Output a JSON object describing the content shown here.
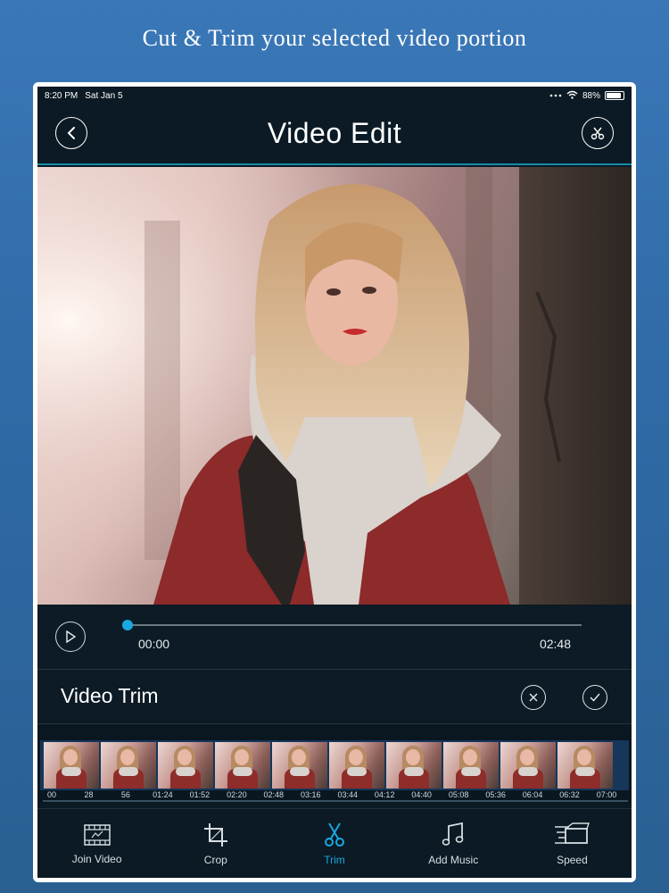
{
  "headline": "Cut & Trim your selected video portion",
  "status": {
    "time": "8:20 PM",
    "date": "Sat Jan 5",
    "battery": "88%",
    "battery_level": 0.88
  },
  "nav": {
    "title": "Video Edit",
    "back_icon": "chevron-left-icon",
    "share_icon": "scissors-icon"
  },
  "player": {
    "current_time": "00:00",
    "duration": "02:48",
    "progress": 0.0
  },
  "trim": {
    "title": "Video Trim"
  },
  "timeline": {
    "ticks": [
      "00",
      "28",
      "56",
      "01:24",
      "01:52",
      "02:20",
      "02:48",
      "03:16",
      "03:44",
      "04:12",
      "04:40",
      "05:08",
      "05:36",
      "06:04",
      "06:32",
      "07:00"
    ]
  },
  "toolbar": {
    "items": [
      {
        "label": "Join Video",
        "icon": "film-icon"
      },
      {
        "label": "Crop",
        "icon": "crop-icon"
      },
      {
        "label": "Trim",
        "icon": "scissors-icon",
        "active": true
      },
      {
        "label": "Add Music",
        "icon": "music-note-icon"
      },
      {
        "label": "Speed",
        "icon": "speed-icon"
      }
    ]
  },
  "colors": {
    "accent": "#1aa8e0",
    "background": "#0b1a24",
    "page": "#3a77b7"
  }
}
